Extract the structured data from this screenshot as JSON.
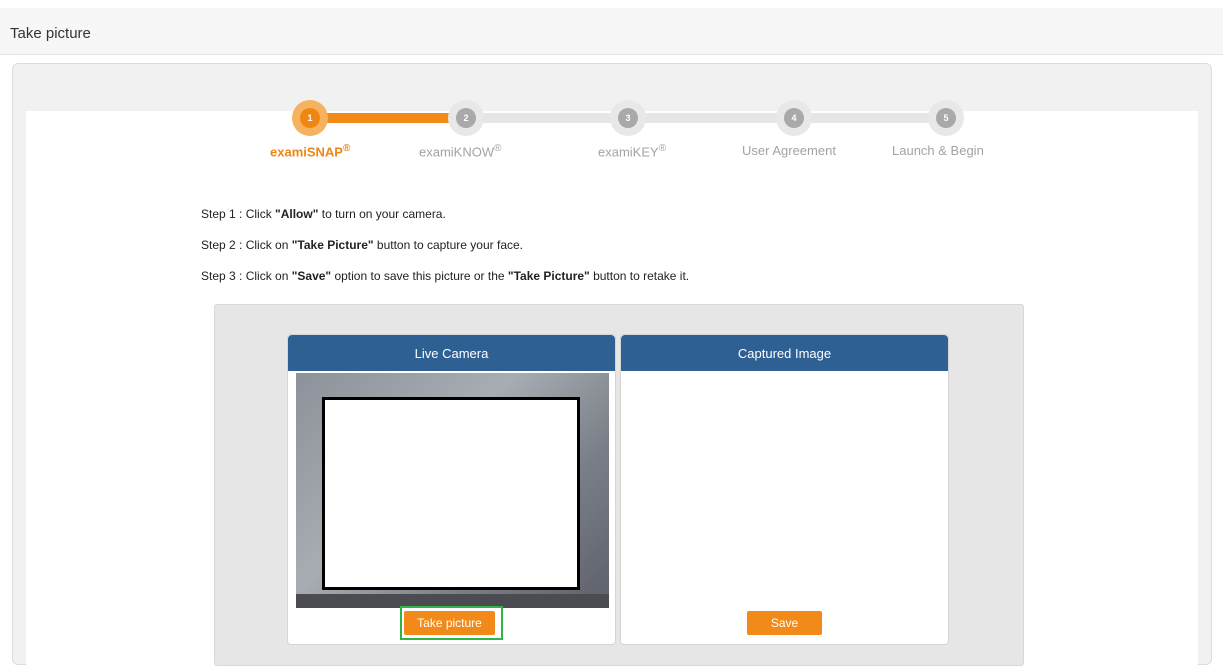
{
  "page": {
    "title": "Take picture"
  },
  "colors": {
    "accent": "#f28a1a",
    "header_blue": "#2f6094",
    "highlight": "#2fb44a"
  },
  "stepper": {
    "steps": [
      {
        "number": "1",
        "label": "examiSNAP",
        "mark": "®",
        "active": true
      },
      {
        "number": "2",
        "label": "examiKNOW",
        "mark": "®",
        "active": false
      },
      {
        "number": "3",
        "label": "examiKEY",
        "mark": "®",
        "active": false
      },
      {
        "number": "4",
        "label": "User Agreement",
        "mark": "",
        "active": false
      },
      {
        "number": "5",
        "label": "Launch & Begin",
        "mark": "",
        "active": false
      }
    ]
  },
  "instructions": {
    "step1": {
      "prefix": "Step 1 : Click ",
      "bold": "\"Allow\"",
      "suffix": " to turn on your camera."
    },
    "step2": {
      "prefix": "Step 2 : Click on ",
      "bold": "\"Take Picture\"",
      "suffix": " button to capture your face."
    },
    "step3": {
      "prefix": "Step 3 : Click on ",
      "bold": "\"Save\"",
      "mid": " option to save this picture or the ",
      "bold2": "\"Take Picture\"",
      "suffix": " button to retake it."
    }
  },
  "live_camera": {
    "title": "Live Camera",
    "button": "Take picture"
  },
  "captured_image": {
    "title": "Captured Image",
    "button": "Save"
  }
}
